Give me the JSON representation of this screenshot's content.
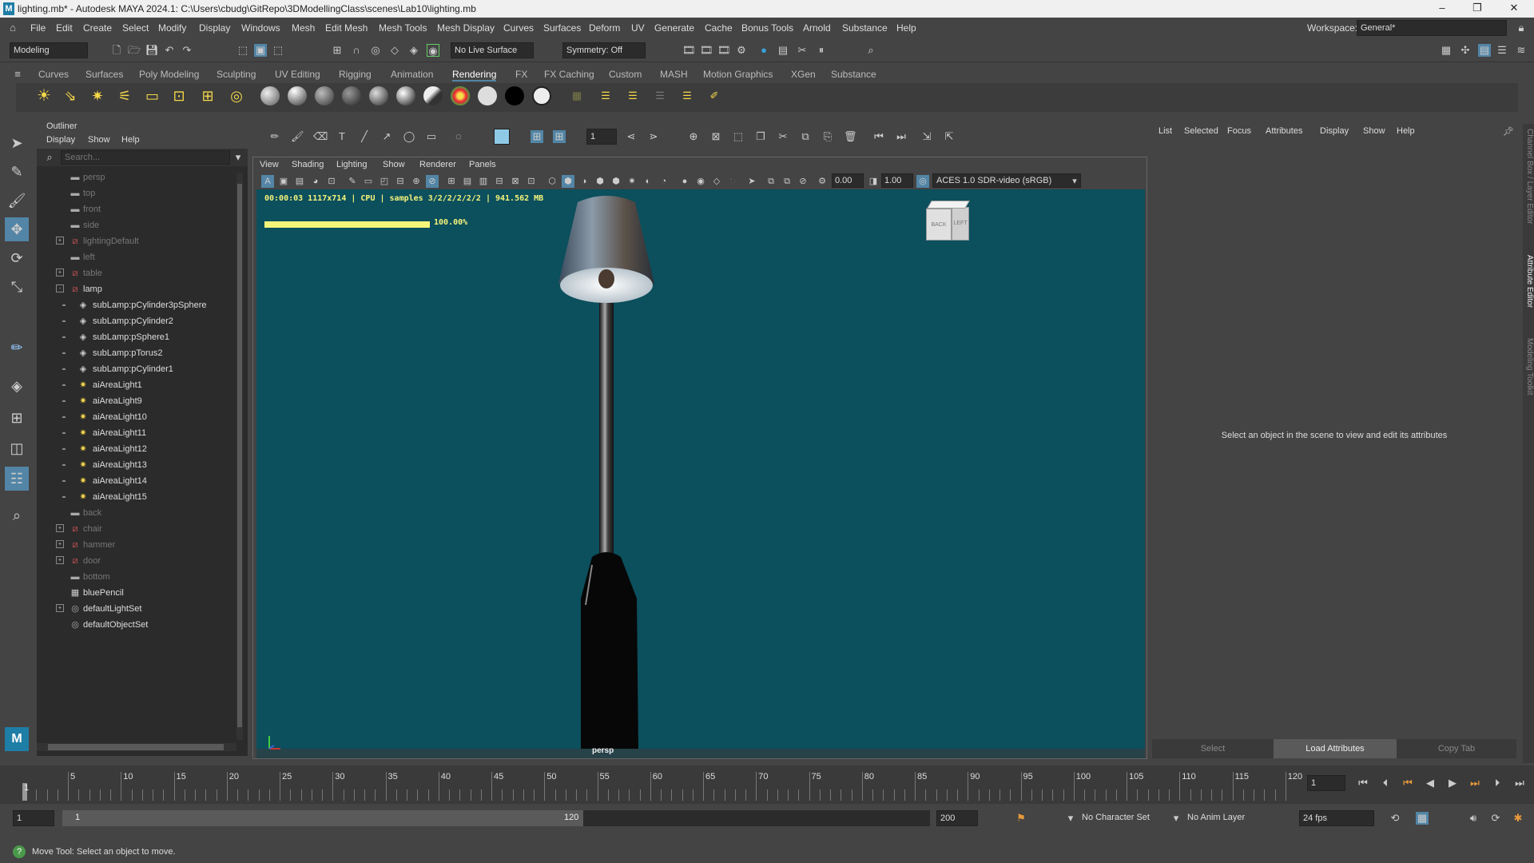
{
  "title": "lighting.mb* - Autodesk MAYA 2024.1: C:\\Users\\cbudg\\GitRepo\\3DModellingClass\\scenes\\Lab10\\lighting.mb",
  "menu": [
    "File",
    "Edit",
    "Create",
    "Select",
    "Modify",
    "Display",
    "Windows",
    "Mesh",
    "Edit Mesh",
    "Mesh Tools",
    "Mesh Display",
    "Curves",
    "Surfaces",
    "Deform",
    "UV",
    "Generate",
    "Cache",
    "Bonus Tools",
    "Arnold",
    "Substance",
    "Help"
  ],
  "workspace": {
    "label": "Workspace:",
    "value": "General*"
  },
  "status": {
    "mode": "Modeling",
    "live_surface": "No Live Surface",
    "symmetry": "Symmetry: Off"
  },
  "shelf_tabs": [
    "Curves",
    "Surfaces",
    "Poly Modeling",
    "Sculpting",
    "UV Editing",
    "Rigging",
    "Animation",
    "Rendering",
    "FX",
    "FX Caching",
    "Custom",
    "MASH",
    "Motion Graphics",
    "XGen",
    "Substance"
  ],
  "active_shelf": "Rendering",
  "outliner": {
    "title": "Outliner",
    "menu": [
      "Display",
      "Show",
      "Help"
    ],
    "search_placeholder": "Search...",
    "items": [
      {
        "label": "persp",
        "icon": "camera-icon",
        "dim": true
      },
      {
        "label": "top",
        "icon": "camera-icon",
        "dim": true
      },
      {
        "label": "front",
        "icon": "camera-icon",
        "dim": true
      },
      {
        "label": "side",
        "icon": "camera-icon",
        "dim": true
      },
      {
        "label": "lightingDefault",
        "icon": "group-icon",
        "dim": true,
        "expand": "+"
      },
      {
        "label": "left",
        "icon": "camera-icon",
        "dim": true
      },
      {
        "label": "table",
        "icon": "group-icon",
        "dim": true,
        "expand": "+"
      },
      {
        "label": "lamp",
        "icon": "group-icon",
        "dim": false,
        "expand": "-"
      },
      {
        "label": "subLamp:pCylinder3pSphere",
        "icon": "mesh-icon",
        "dim": false,
        "indent": true
      },
      {
        "label": "subLamp:pCylinder2",
        "icon": "mesh-icon",
        "dim": false,
        "indent": true
      },
      {
        "label": "subLamp:pSphere1",
        "icon": "mesh-icon",
        "dim": false,
        "indent": true
      },
      {
        "label": "subLamp:pTorus2",
        "icon": "mesh-icon",
        "dim": false,
        "indent": true
      },
      {
        "label": "subLamp:pCylinder1",
        "icon": "mesh-icon",
        "dim": false,
        "indent": true
      },
      {
        "label": "aiAreaLight1",
        "icon": "area-light-icon",
        "dim": false,
        "indent": true
      },
      {
        "label": "aiAreaLight9",
        "icon": "area-light-icon",
        "dim": false,
        "indent": true
      },
      {
        "label": "aiAreaLight10",
        "icon": "area-light-icon",
        "dim": false,
        "indent": true
      },
      {
        "label": "aiAreaLight11",
        "icon": "area-light-icon",
        "dim": false,
        "indent": true
      },
      {
        "label": "aiAreaLight12",
        "icon": "area-light-icon",
        "dim": false,
        "indent": true
      },
      {
        "label": "aiAreaLight13",
        "icon": "area-light-icon",
        "dim": false,
        "indent": true
      },
      {
        "label": "aiAreaLight14",
        "icon": "area-light-icon",
        "dim": false,
        "indent": true
      },
      {
        "label": "aiAreaLight15",
        "icon": "area-light-icon",
        "dim": false,
        "indent": true
      },
      {
        "label": "back",
        "icon": "camera-icon",
        "dim": true
      },
      {
        "label": "chair",
        "icon": "group-icon",
        "dim": true,
        "expand": "+"
      },
      {
        "label": "hammer",
        "icon": "group-icon",
        "dim": true,
        "expand": "+"
      },
      {
        "label": "door",
        "icon": "group-icon",
        "dim": true,
        "expand": "+"
      },
      {
        "label": "bottom",
        "icon": "camera-icon",
        "dim": true
      },
      {
        "label": "bluePencil",
        "icon": "pencil-icon",
        "dim": false
      },
      {
        "label": "defaultLightSet",
        "icon": "set-icon",
        "dim": false,
        "expand": "+"
      },
      {
        "label": "defaultObjectSet",
        "icon": "set-icon",
        "dim": false
      }
    ]
  },
  "viewport": {
    "menu": [
      "View",
      "Shading",
      "Lighting",
      "Show",
      "Renderer",
      "Panels"
    ],
    "field1": "0.00",
    "field2": "1.00",
    "colorspace": "ACES 1.0 SDR-video (sRGB)",
    "render_info": "00:00:03 1117x714 | CPU | samples 3/2/2/2/2/2 | 941.562 MB",
    "progress_label": "100.00%",
    "progress": 1.0,
    "camera": "persp",
    "cube_back": "BACK",
    "cube_left": "LEFT"
  },
  "attr": {
    "menu": [
      "List",
      "Selected",
      "Focus",
      "Attributes",
      "Display",
      "Show",
      "Help"
    ],
    "message": "Select an object in the scene to view and edit its attributes",
    "buttons": [
      "Select",
      "Load Attributes",
      "Copy Tab"
    ],
    "side_tabs": [
      "Channel Box / Layer Editor",
      "Attribute Editor",
      "Modeling Toolkit"
    ]
  },
  "timeline": {
    "ticks": [
      "5",
      "10",
      "15",
      "20",
      "25",
      "30",
      "35",
      "40",
      "45",
      "50",
      "55",
      "60",
      "65",
      "70",
      "75",
      "80",
      "85",
      "90",
      "95",
      "100",
      "105",
      "110",
      "115",
      "120"
    ],
    "start": "1",
    "current": "1"
  },
  "range": {
    "start": "1",
    "inner_start": "1",
    "inner_end": "120",
    "end": "200",
    "char_set": "No Character Set",
    "anim_layer": "No Anim Layer",
    "fps": "24 fps"
  },
  "help": "Move Tool: Select an object to move.",
  "colors": {
    "accent": "#5285a6",
    "viewport_bg": "#0c4f5d",
    "progress": "#f5f57a"
  }
}
